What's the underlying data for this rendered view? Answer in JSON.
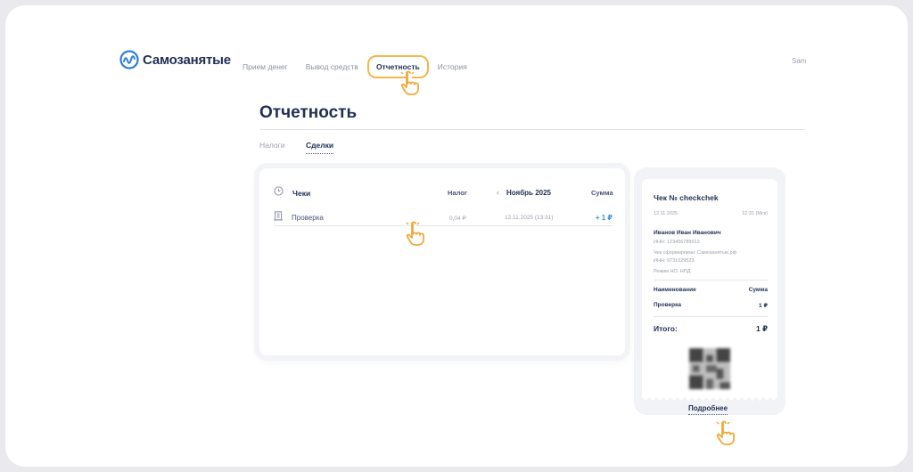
{
  "brand": {
    "name": "Самозанятые"
  },
  "nav": {
    "items": [
      "Прием денег",
      "Вывод средств",
      "Отчетность",
      "История"
    ],
    "active": "Отчетность",
    "user_short": "Sam"
  },
  "page": {
    "title": "Отчетность",
    "tabs": [
      "Налоги",
      "Сделки"
    ],
    "active_tab": "Сделки"
  },
  "receipts": {
    "title": "Чеки",
    "tax_header": "Налог",
    "month": "Ноябрь 2025",
    "sum_header": "Сумма",
    "rows": [
      {
        "name": "Проверка",
        "tax": "0,04 ₽",
        "date": "12.11.2025 (13:31)",
        "amount": "+ 1 ₽"
      }
    ]
  },
  "receipt": {
    "title": "Чек № checkchek",
    "date": "12.11.2025",
    "time": "12:31 (Мск)",
    "person": "Иванов Иван Иванович",
    "inn": "ИНН: 123456789012",
    "formed_by": "Чек сформирован: Самозанятые.рф",
    "formed_inn": "ИНН: 9731029523",
    "regime": "Режим НО: НПД",
    "col_name": "Наименование",
    "col_sum": "Сумма",
    "item_name": "Проверка",
    "item_sum": "1 ₽",
    "total_label": "Итого:",
    "total_value": "1 ₽"
  },
  "more_link": "Подробнее",
  "colors": {
    "accent": "#f5b74b",
    "brand": "#1f2f54",
    "amount": "#3b8fd9"
  }
}
